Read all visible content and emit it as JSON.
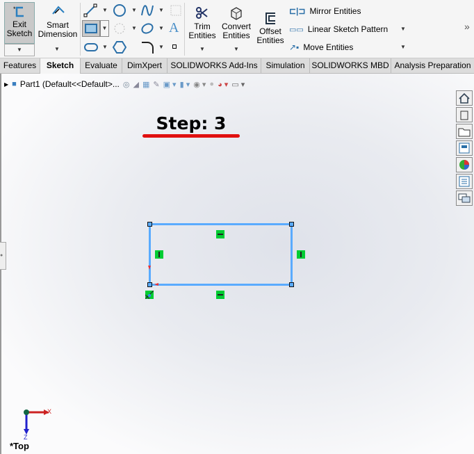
{
  "ribbon": {
    "exit_sketch": "Exit\nSketch",
    "exit_line1": "Exit",
    "exit_line2": "Sketch",
    "smart_line1": "Smart",
    "smart_line2": "Dimension",
    "trim_line1": "Trim",
    "trim_line2": "Entities",
    "convert_line1": "Convert",
    "convert_line2": "Entities",
    "offset_line1": "Offset",
    "offset_line2": "Entities",
    "mirror": "Mirror Entities",
    "linear_pattern": "Linear Sketch Pattern",
    "move": "Move Entities",
    "more": "»"
  },
  "tabs": [
    "Features",
    "Sketch",
    "Evaluate",
    "DimXpert",
    "SOLIDWORKS Add-Ins",
    "Simulation",
    "SOLIDWORKS MBD",
    "Analysis Preparation"
  ],
  "active_tab": "Sketch",
  "tree": {
    "part": "Part1  (Default<<Default>..."
  },
  "annotation": {
    "text": "Step: 3",
    "underline_color": "#e01010"
  },
  "sketch": {
    "line_color": "#5aabff",
    "relation_color": "#00cc33"
  },
  "triad": {
    "x": "X",
    "z": "Z"
  },
  "view_label": "*Top"
}
